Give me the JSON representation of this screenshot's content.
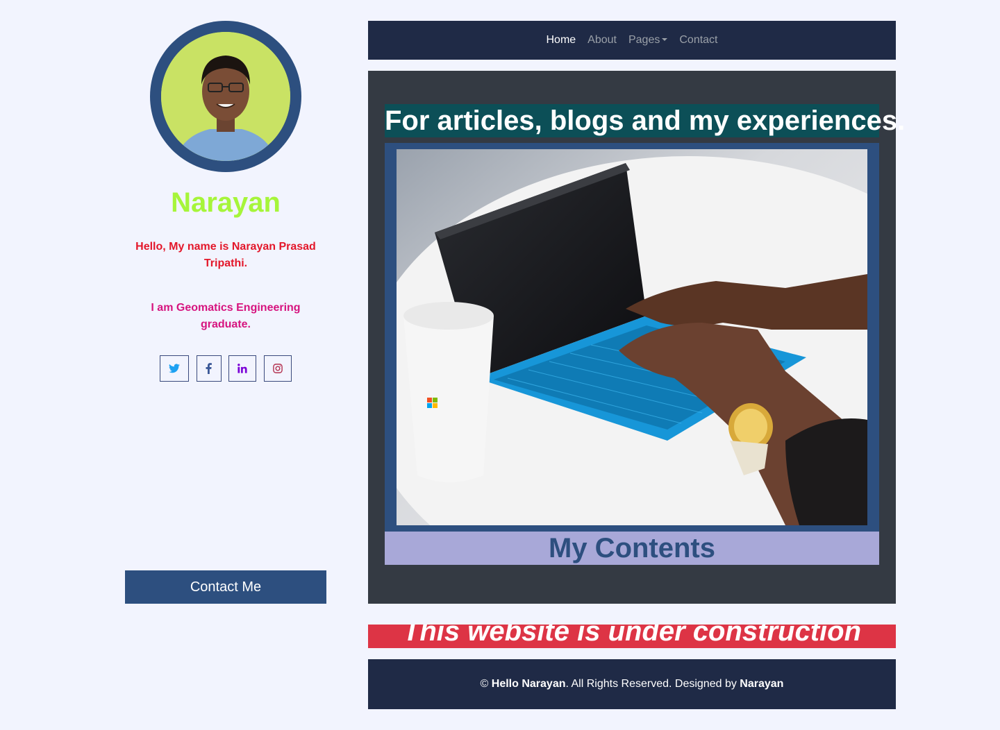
{
  "profile": {
    "name": "Narayan",
    "intro": "Hello, My name is Narayan Prasad Tripathi.",
    "education": "I am Geomatics Engineering graduate.",
    "contact_button": "Contact Me",
    "socials": [
      {
        "icon": "twitter-icon",
        "color": "#1da1f2"
      },
      {
        "icon": "facebook-icon",
        "color": "#3b5998"
      },
      {
        "icon": "linkedin-icon",
        "color": "#7a00d6"
      },
      {
        "icon": "instagram-icon",
        "color": "#b3304f"
      }
    ]
  },
  "nav": {
    "items": [
      {
        "label": "Home",
        "active": true
      },
      {
        "label": "About",
        "active": false
      },
      {
        "label": "Pages",
        "active": false,
        "dropdown": true
      },
      {
        "label": "Contact",
        "active": false
      }
    ]
  },
  "main": {
    "headline": "For articles, blogs and my experiences.",
    "section_title": "My Contents"
  },
  "banner": {
    "text": "This website is under construction"
  },
  "footer": {
    "copyright_symbol": "©",
    "site_name": "Hello Narayan",
    "rights_text": ". All Rights Reserved. Designed by",
    "designer": "Narayan"
  },
  "colors": {
    "page_bg": "#f2f4fe",
    "navy": "#1f2a46",
    "brand_blue": "#2d4f7f",
    "name_green": "#a6f53a",
    "intro_red": "#e3172a",
    "education_pink": "#d6147f",
    "teal": "#0c4f57",
    "lavender": "#a8a8d8",
    "banner_red": "#dd3445"
  }
}
